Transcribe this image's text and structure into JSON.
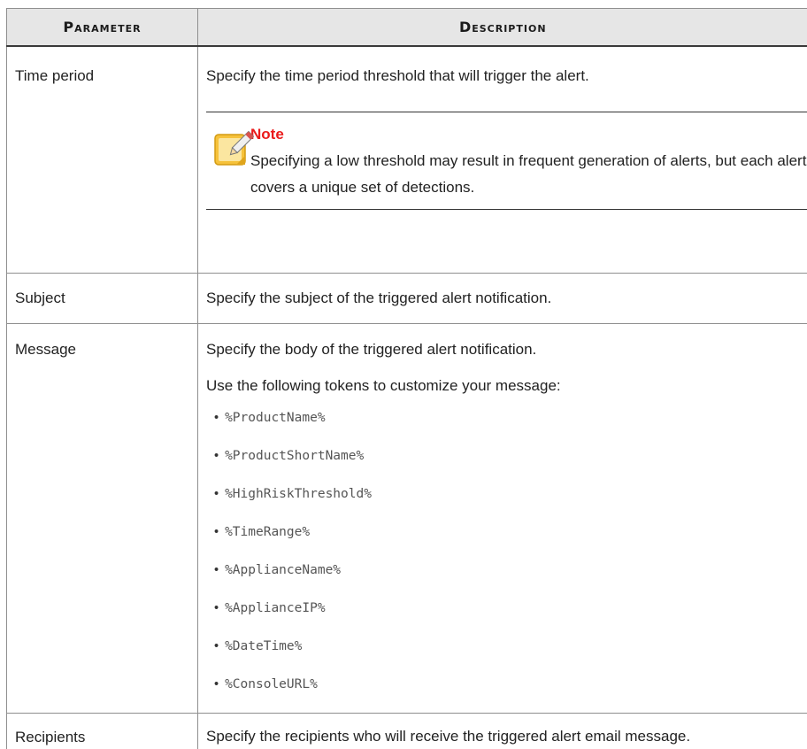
{
  "table": {
    "headers": {
      "parameter": "Parameter",
      "description": "Description"
    },
    "rows": [
      {
        "parameter": "Time period",
        "description": "Specify the time period threshold that will trigger the alert.",
        "note": {
          "icon": "note-pencil-icon",
          "title": "Note",
          "text": "Specifying a low threshold may result in frequent generation of alerts, but each alert covers a unique set of detections."
        }
      },
      {
        "parameter": "Subject",
        "description": "Specify the subject of the triggered alert notification."
      },
      {
        "parameter": "Message",
        "description": "Specify the body of the triggered alert notification.",
        "description2": "Use the following tokens to customize your message:",
        "tokens": [
          "%ProductName%",
          "%ProductShortName%",
          "%HighRiskThreshold%",
          "%TimeRange%",
          "%ApplianceName%",
          "%ApplianceIP%",
          "%DateTime%",
          "%ConsoleURL%"
        ]
      },
      {
        "parameter": "Recipients",
        "description": "Specify the recipients who will receive the triggered alert email message."
      }
    ]
  },
  "colors": {
    "note_title": "#ea1b1b",
    "header_bg": "#e6e6e6",
    "note_icon": "#f6c23b"
  }
}
